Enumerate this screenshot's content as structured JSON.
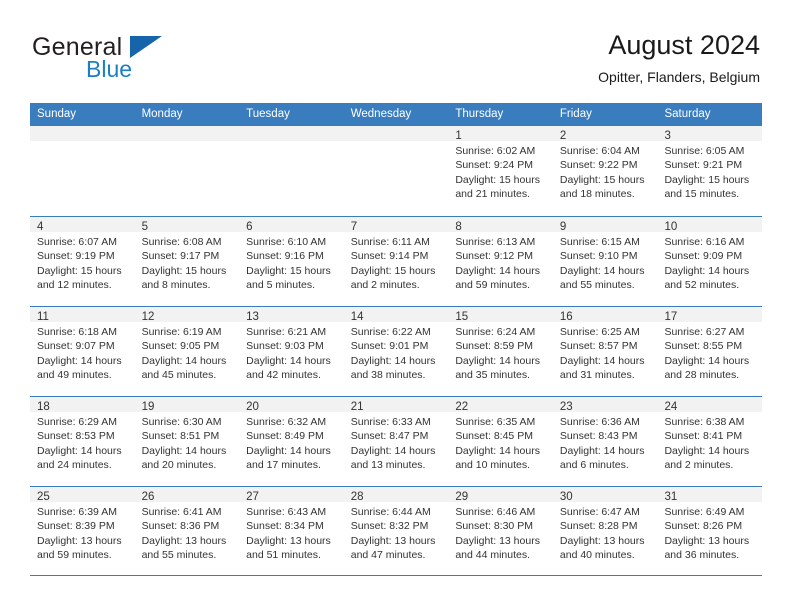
{
  "brand": {
    "word1": "General",
    "word2": "Blue",
    "triangle_color": "#1664a9",
    "blue_text_color": "#1b7fc4"
  },
  "header": {
    "title": "August 2024",
    "subtitle": "Opitter, Flanders, Belgium"
  },
  "theme": {
    "header_blue": "#3a7dbf",
    "day_strip_gray": "#f2f2f2"
  },
  "weekdays": [
    "Sunday",
    "Monday",
    "Tuesday",
    "Wednesday",
    "Thursday",
    "Friday",
    "Saturday"
  ],
  "weeks": [
    [
      {
        "num": ""
      },
      {
        "num": ""
      },
      {
        "num": ""
      },
      {
        "num": ""
      },
      {
        "num": "1",
        "sunrise": "Sunrise: 6:02 AM",
        "sunset": "Sunset: 9:24 PM",
        "daylight1": "Daylight: 15 hours",
        "daylight2": "and 21 minutes."
      },
      {
        "num": "2",
        "sunrise": "Sunrise: 6:04 AM",
        "sunset": "Sunset: 9:22 PM",
        "daylight1": "Daylight: 15 hours",
        "daylight2": "and 18 minutes."
      },
      {
        "num": "3",
        "sunrise": "Sunrise: 6:05 AM",
        "sunset": "Sunset: 9:21 PM",
        "daylight1": "Daylight: 15 hours",
        "daylight2": "and 15 minutes."
      }
    ],
    [
      {
        "num": "4",
        "sunrise": "Sunrise: 6:07 AM",
        "sunset": "Sunset: 9:19 PM",
        "daylight1": "Daylight: 15 hours",
        "daylight2": "and 12 minutes."
      },
      {
        "num": "5",
        "sunrise": "Sunrise: 6:08 AM",
        "sunset": "Sunset: 9:17 PM",
        "daylight1": "Daylight: 15 hours",
        "daylight2": "and 8 minutes."
      },
      {
        "num": "6",
        "sunrise": "Sunrise: 6:10 AM",
        "sunset": "Sunset: 9:16 PM",
        "daylight1": "Daylight: 15 hours",
        "daylight2": "and 5 minutes."
      },
      {
        "num": "7",
        "sunrise": "Sunrise: 6:11 AM",
        "sunset": "Sunset: 9:14 PM",
        "daylight1": "Daylight: 15 hours",
        "daylight2": "and 2 minutes."
      },
      {
        "num": "8",
        "sunrise": "Sunrise: 6:13 AM",
        "sunset": "Sunset: 9:12 PM",
        "daylight1": "Daylight: 14 hours",
        "daylight2": "and 59 minutes."
      },
      {
        "num": "9",
        "sunrise": "Sunrise: 6:15 AM",
        "sunset": "Sunset: 9:10 PM",
        "daylight1": "Daylight: 14 hours",
        "daylight2": "and 55 minutes."
      },
      {
        "num": "10",
        "sunrise": "Sunrise: 6:16 AM",
        "sunset": "Sunset: 9:09 PM",
        "daylight1": "Daylight: 14 hours",
        "daylight2": "and 52 minutes."
      }
    ],
    [
      {
        "num": "11",
        "sunrise": "Sunrise: 6:18 AM",
        "sunset": "Sunset: 9:07 PM",
        "daylight1": "Daylight: 14 hours",
        "daylight2": "and 49 minutes."
      },
      {
        "num": "12",
        "sunrise": "Sunrise: 6:19 AM",
        "sunset": "Sunset: 9:05 PM",
        "daylight1": "Daylight: 14 hours",
        "daylight2": "and 45 minutes."
      },
      {
        "num": "13",
        "sunrise": "Sunrise: 6:21 AM",
        "sunset": "Sunset: 9:03 PM",
        "daylight1": "Daylight: 14 hours",
        "daylight2": "and 42 minutes."
      },
      {
        "num": "14",
        "sunrise": "Sunrise: 6:22 AM",
        "sunset": "Sunset: 9:01 PM",
        "daylight1": "Daylight: 14 hours",
        "daylight2": "and 38 minutes."
      },
      {
        "num": "15",
        "sunrise": "Sunrise: 6:24 AM",
        "sunset": "Sunset: 8:59 PM",
        "daylight1": "Daylight: 14 hours",
        "daylight2": "and 35 minutes."
      },
      {
        "num": "16",
        "sunrise": "Sunrise: 6:25 AM",
        "sunset": "Sunset: 8:57 PM",
        "daylight1": "Daylight: 14 hours",
        "daylight2": "and 31 minutes."
      },
      {
        "num": "17",
        "sunrise": "Sunrise: 6:27 AM",
        "sunset": "Sunset: 8:55 PM",
        "daylight1": "Daylight: 14 hours",
        "daylight2": "and 28 minutes."
      }
    ],
    [
      {
        "num": "18",
        "sunrise": "Sunrise: 6:29 AM",
        "sunset": "Sunset: 8:53 PM",
        "daylight1": "Daylight: 14 hours",
        "daylight2": "and 24 minutes."
      },
      {
        "num": "19",
        "sunrise": "Sunrise: 6:30 AM",
        "sunset": "Sunset: 8:51 PM",
        "daylight1": "Daylight: 14 hours",
        "daylight2": "and 20 minutes."
      },
      {
        "num": "20",
        "sunrise": "Sunrise: 6:32 AM",
        "sunset": "Sunset: 8:49 PM",
        "daylight1": "Daylight: 14 hours",
        "daylight2": "and 17 minutes."
      },
      {
        "num": "21",
        "sunrise": "Sunrise: 6:33 AM",
        "sunset": "Sunset: 8:47 PM",
        "daylight1": "Daylight: 14 hours",
        "daylight2": "and 13 minutes."
      },
      {
        "num": "22",
        "sunrise": "Sunrise: 6:35 AM",
        "sunset": "Sunset: 8:45 PM",
        "daylight1": "Daylight: 14 hours",
        "daylight2": "and 10 minutes."
      },
      {
        "num": "23",
        "sunrise": "Sunrise: 6:36 AM",
        "sunset": "Sunset: 8:43 PM",
        "daylight1": "Daylight: 14 hours",
        "daylight2": "and 6 minutes."
      },
      {
        "num": "24",
        "sunrise": "Sunrise: 6:38 AM",
        "sunset": "Sunset: 8:41 PM",
        "daylight1": "Daylight: 14 hours",
        "daylight2": "and 2 minutes."
      }
    ],
    [
      {
        "num": "25",
        "sunrise": "Sunrise: 6:39 AM",
        "sunset": "Sunset: 8:39 PM",
        "daylight1": "Daylight: 13 hours",
        "daylight2": "and 59 minutes."
      },
      {
        "num": "26",
        "sunrise": "Sunrise: 6:41 AM",
        "sunset": "Sunset: 8:36 PM",
        "daylight1": "Daylight: 13 hours",
        "daylight2": "and 55 minutes."
      },
      {
        "num": "27",
        "sunrise": "Sunrise: 6:43 AM",
        "sunset": "Sunset: 8:34 PM",
        "daylight1": "Daylight: 13 hours",
        "daylight2": "and 51 minutes."
      },
      {
        "num": "28",
        "sunrise": "Sunrise: 6:44 AM",
        "sunset": "Sunset: 8:32 PM",
        "daylight1": "Daylight: 13 hours",
        "daylight2": "and 47 minutes."
      },
      {
        "num": "29",
        "sunrise": "Sunrise: 6:46 AM",
        "sunset": "Sunset: 8:30 PM",
        "daylight1": "Daylight: 13 hours",
        "daylight2": "and 44 minutes."
      },
      {
        "num": "30",
        "sunrise": "Sunrise: 6:47 AM",
        "sunset": "Sunset: 8:28 PM",
        "daylight1": "Daylight: 13 hours",
        "daylight2": "and 40 minutes."
      },
      {
        "num": "31",
        "sunrise": "Sunrise: 6:49 AM",
        "sunset": "Sunset: 8:26 PM",
        "daylight1": "Daylight: 13 hours",
        "daylight2": "and 36 minutes."
      }
    ]
  ]
}
